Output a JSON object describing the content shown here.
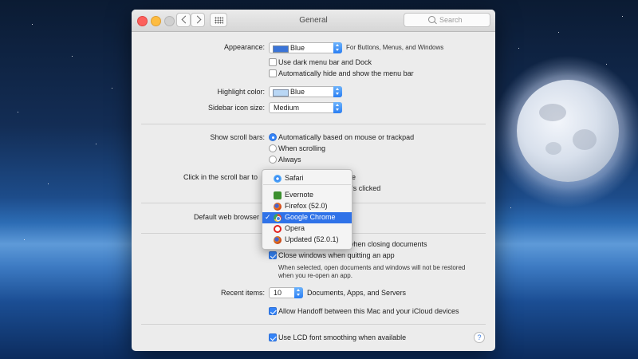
{
  "window": {
    "title": "General"
  },
  "search": {
    "placeholder": "Search"
  },
  "appearance": {
    "label": "Appearance:",
    "value": "Blue",
    "swatch_color": "#3a74d8",
    "note": "For Buttons, Menus, and Windows"
  },
  "options": {
    "dark_menu": "Use dark menu bar and Dock",
    "auto_hide_menu": "Automatically hide and show the menu bar"
  },
  "highlight": {
    "label": "Highlight color:",
    "value": "Blue",
    "swatch_color": "#b9d7f5"
  },
  "sidebar_icon": {
    "label": "Sidebar icon size:",
    "value": "Medium"
  },
  "scroll_bars": {
    "label": "Show scroll bars:",
    "options": [
      "Automatically based on mouse or trackpad",
      "When scrolling",
      "Always"
    ],
    "selected": 0
  },
  "click_scroll": {
    "label": "Click in the scroll bar to",
    "partial1": "e",
    "partial2": "'s clicked"
  },
  "browser": {
    "label": "Default web browser",
    "menu": [
      "Safari",
      "Evernote",
      "Firefox (52.0)",
      "Google Chrome",
      "Opera",
      "Updated (52.0.1)"
    ],
    "selected": 3
  },
  "documents": {
    "ask_keep": "when closing documents",
    "close_windows": "Close windows when quitting an app",
    "close_windows_note_1": "When selected, open documents and windows will not be restored",
    "close_windows_note_2": "when you re-open an app."
  },
  "recent": {
    "label": "Recent items:",
    "value": "10",
    "suffix": "Documents, Apps, and Servers"
  },
  "handoff": "Allow Handoff between this Mac and your iCloud devices",
  "lcd": "Use LCD font smoothing when available",
  "help": "?"
}
